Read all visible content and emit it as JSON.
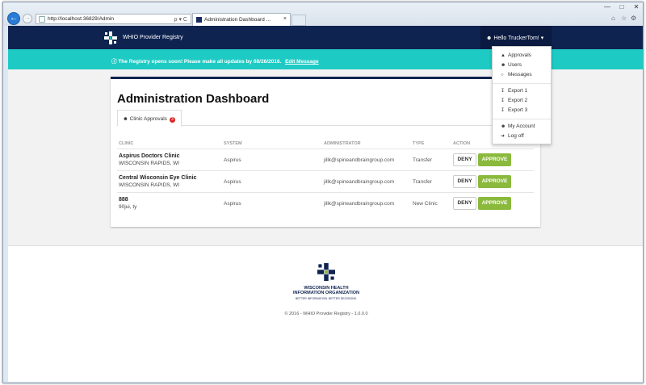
{
  "browser": {
    "url": "http://localhost:36829/Admin",
    "address_controls": "ρ ▾ C",
    "tab_title": "Administration Dashboard ...",
    "tab_close": "×",
    "back_glyph": "←",
    "forward_glyph": "→",
    "window_controls": {
      "minimize": "—",
      "maximize": "□",
      "close": "✕"
    },
    "toolbar_icons": [
      "home-icon",
      "star-icon",
      "gear-icon"
    ]
  },
  "navbar": {
    "brand": "WHIO Provider Registry",
    "user_label": "Hello TruckerTom!"
  },
  "banner": {
    "message": "The Registry opens soon! Please make all updates by 08/26/2016.",
    "link": "Edit Message"
  },
  "dashboard": {
    "title": "Administration Dashboard",
    "tab_label": "Clinic Approvals",
    "tab_badge": "3",
    "columns": [
      "CLINIC",
      "SYSTEM",
      "ADMINISTRATOR",
      "TYPE",
      "ACTION"
    ],
    "rows": [
      {
        "name": "Aspirus Doctors Clinic",
        "location": "WISCONSIN RAPIDS, WI",
        "system": "Aspirus",
        "admin": "jillk@spineandbraingroup.com",
        "type": "Transfer",
        "deny": "DENY",
        "approve": "APPROVE"
      },
      {
        "name": "Central Wisconsin Eye Clinic",
        "location": "WISCONSIN RAPIDS, WI",
        "system": "Aspirus",
        "admin": "jillk@spineandbraingroup.com",
        "type": "Transfer",
        "deny": "DENY",
        "approve": "APPROVE"
      },
      {
        "name": "888",
        "location": "90jui, ty",
        "system": "Aspirus",
        "admin": "jillk@spineandbraingroup.com",
        "type": "New Clinic",
        "deny": "DENY",
        "approve": "APPROVE"
      }
    ]
  },
  "user_menu": {
    "items": [
      "Approvals",
      "Users",
      "Messages",
      "Export 1",
      "Export 2",
      "Export 3",
      "My Account",
      "Log off"
    ],
    "icons": [
      "thumbs-up-icon",
      "users-icon",
      "comment-icon",
      "download-icon",
      "download-icon",
      "download-icon",
      "user-icon",
      "sign-out-icon"
    ]
  },
  "footer": {
    "org_line1": "WISCONSIN HEALTH",
    "org_line2": "INFORMATION ORGANIZATION",
    "tagline": "BETTER INFORMATION. BETTER DECISIONS.",
    "copyright": "© 2016 - WHIO Provider Registry - 1.0.0.0"
  },
  "colors": {
    "navy": "#0f2350",
    "teal": "#1ecbc4",
    "approve_green": "#8ab93c",
    "badge_red": "#d9241f",
    "page_gray": "#f2f2f2"
  }
}
